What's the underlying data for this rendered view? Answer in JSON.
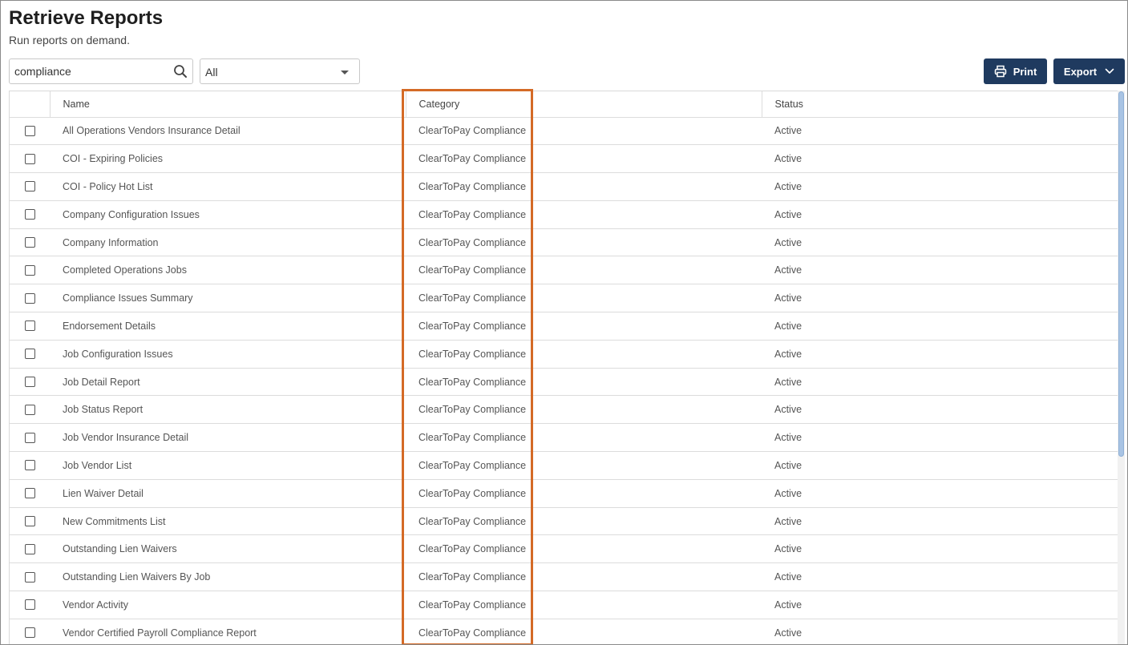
{
  "header": {
    "title": "Retrieve Reports",
    "subtitle": "Run reports on demand."
  },
  "toolbar": {
    "search_value": "compliance",
    "search_icon": "search-icon",
    "filter_selected": "All",
    "print_label": "Print",
    "print_icon": "printer-icon",
    "export_label": "Export",
    "export_icon": "chevron-down-icon"
  },
  "colors": {
    "button_bg": "#1f3a5f",
    "highlight_border": "#d46a26",
    "scroll_thumb": "#a9c4e4"
  },
  "table": {
    "columns": [
      "Name",
      "Category",
      "Status"
    ],
    "rows": [
      {
        "name": "All Operations Vendors Insurance Detail",
        "category": "ClearToPay Compliance",
        "status": "Active"
      },
      {
        "name": "COI - Expiring Policies",
        "category": "ClearToPay Compliance",
        "status": "Active"
      },
      {
        "name": "COI - Policy Hot List",
        "category": "ClearToPay Compliance",
        "status": "Active"
      },
      {
        "name": "Company Configuration Issues",
        "category": "ClearToPay Compliance",
        "status": "Active"
      },
      {
        "name": "Company Information",
        "category": "ClearToPay Compliance",
        "status": "Active"
      },
      {
        "name": "Completed Operations Jobs",
        "category": "ClearToPay Compliance",
        "status": "Active"
      },
      {
        "name": "Compliance Issues Summary",
        "category": "ClearToPay Compliance",
        "status": "Active"
      },
      {
        "name": "Endorsement Details",
        "category": "ClearToPay Compliance",
        "status": "Active"
      },
      {
        "name": "Job Configuration Issues",
        "category": "ClearToPay Compliance",
        "status": "Active"
      },
      {
        "name": "Job Detail Report",
        "category": "ClearToPay Compliance",
        "status": "Active"
      },
      {
        "name": "Job Status Report",
        "category": "ClearToPay Compliance",
        "status": "Active"
      },
      {
        "name": "Job Vendor Insurance Detail",
        "category": "ClearToPay Compliance",
        "status": "Active"
      },
      {
        "name": "Job Vendor List",
        "category": "ClearToPay Compliance",
        "status": "Active"
      },
      {
        "name": "Lien Waiver Detail",
        "category": "ClearToPay Compliance",
        "status": "Active"
      },
      {
        "name": "New Commitments List",
        "category": "ClearToPay Compliance",
        "status": "Active"
      },
      {
        "name": "Outstanding Lien Waivers",
        "category": "ClearToPay Compliance",
        "status": "Active"
      },
      {
        "name": "Outstanding Lien Waivers By Job",
        "category": "ClearToPay Compliance",
        "status": "Active"
      },
      {
        "name": "Vendor Activity",
        "category": "ClearToPay Compliance",
        "status": "Active"
      },
      {
        "name": "Vendor Certified Payroll Compliance Report",
        "category": "ClearToPay Compliance",
        "status": "Active"
      }
    ]
  }
}
